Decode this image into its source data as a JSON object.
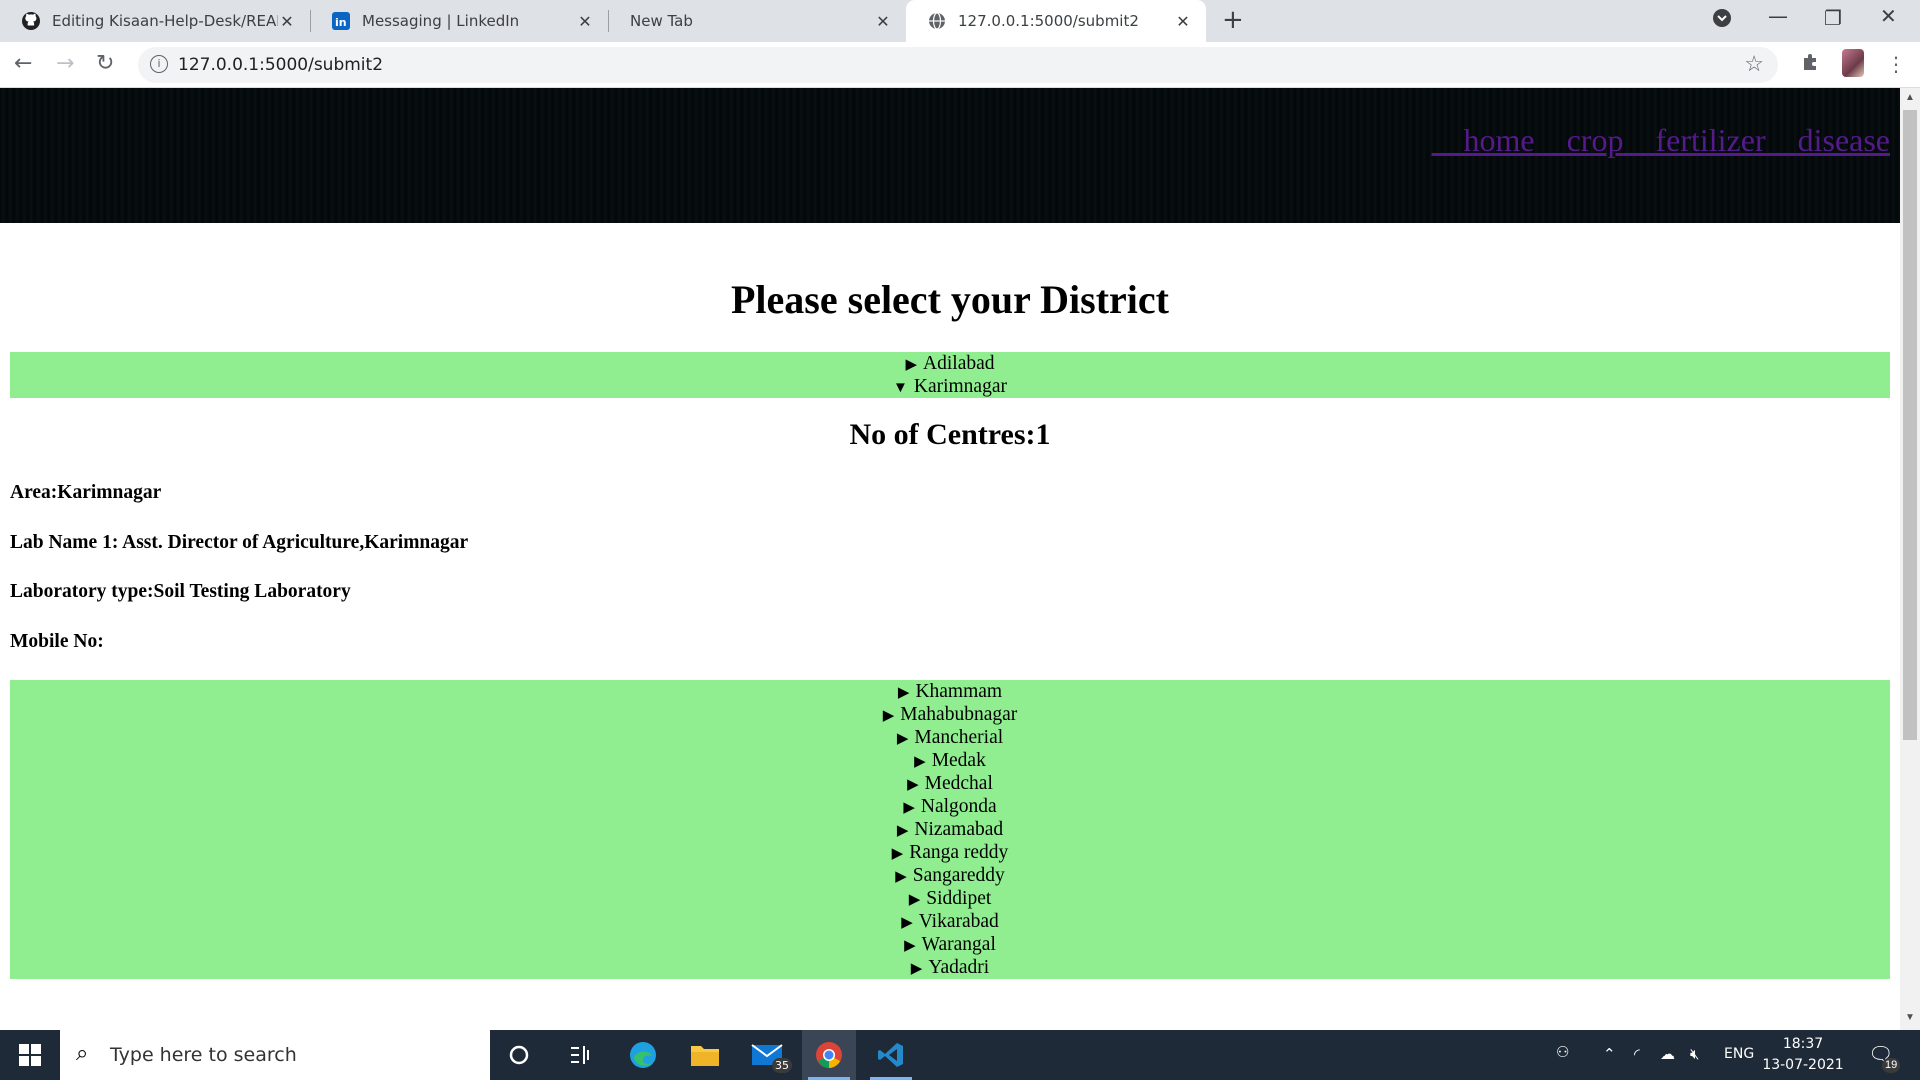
{
  "browser": {
    "tabs": [
      {
        "title": "Editing Kisaan-Help-Desk/READM",
        "icon": "github-icon",
        "active": false
      },
      {
        "title": "Messaging | LinkedIn",
        "icon": "linkedin-icon",
        "active": false
      },
      {
        "title": "New Tab",
        "icon": "",
        "active": false
      },
      {
        "title": "127.0.0.1:5000/submit2",
        "icon": "globe-icon",
        "active": true
      }
    ],
    "url": "127.0.0.1:5000/submit2"
  },
  "page": {
    "nav": [
      {
        "label": "home"
      },
      {
        "label": "crop"
      },
      {
        "label": "fertilizer"
      },
      {
        "label": "disease"
      }
    ],
    "title": "Please select your District",
    "districts_before": [
      "Adilabad"
    ],
    "open_district": "Karimnagar",
    "centres_heading": "No of Centres:1",
    "details": {
      "area": "Area:Karimnagar",
      "lab_name": "Lab Name 1: Asst. Director of Agriculture,Karimnagar",
      "lab_type": "Laboratory type:Soil Testing Laboratory",
      "mobile": "Mobile No:"
    },
    "districts_after": [
      "Khammam",
      "Mahabubnagar",
      "Mancherial",
      "Medak",
      "Medchal",
      "Nalgonda",
      "Nizamabad",
      "Ranga reddy",
      "Sangareddy",
      "Siddipet",
      "Vikarabad",
      "Warangal",
      "Yadadri"
    ],
    "colors": {
      "header_bg": "#050a0b",
      "district_bg": "#90ee90",
      "link": "#551a8b"
    }
  },
  "taskbar": {
    "search_placeholder": "Type here to search",
    "mail_badge": "35",
    "language": "ENG",
    "time": "18:37",
    "date": "13-07-2021",
    "notifications": "19"
  }
}
